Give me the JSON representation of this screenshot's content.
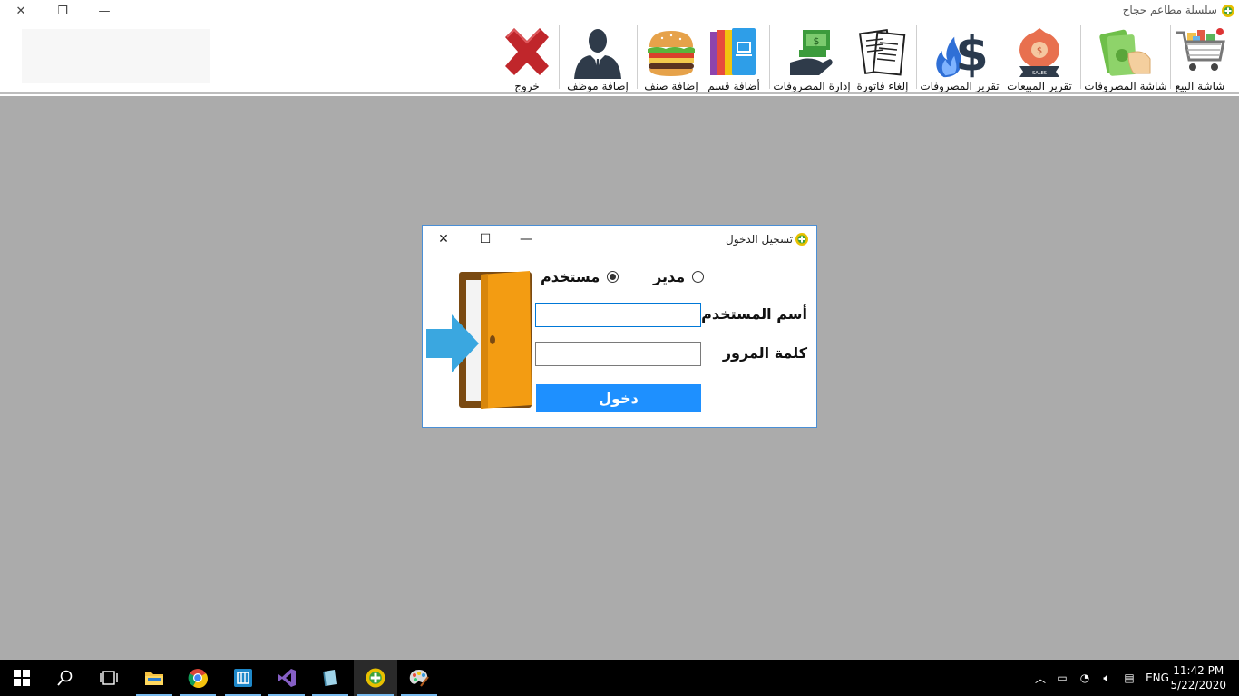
{
  "app": {
    "title": "سلسلة مطاعم حجاج",
    "window_buttons": {
      "close": "✕",
      "restore": "❐",
      "minimize": "—"
    }
  },
  "toolbar": {
    "items": [
      {
        "label": "شاشة البيع",
        "icon": "shopping-cart-icon"
      },
      {
        "label": "شاشة المصروفات",
        "icon": "cash-hand-icon"
      },
      {
        "label": "تقرير المبيعات",
        "icon": "sales-bag-icon"
      },
      {
        "label": "تقرير المصروفات",
        "icon": "dollar-fire-icon"
      },
      {
        "label": "إلغاء فاتورة",
        "icon": "invoice-icon"
      },
      {
        "label": "إدارة المصروفات",
        "icon": "money-hand-icon"
      },
      {
        "label": "أضافة قسم",
        "icon": "category-books-icon"
      },
      {
        "label": "إضافة صنف",
        "icon": "burger-icon"
      },
      {
        "label": "إضافة موظف",
        "icon": "employee-icon"
      },
      {
        "label": "خروج",
        "icon": "exit-x-icon"
      }
    ]
  },
  "login_dialog": {
    "title": "تسجيل الدخول",
    "buttons": {
      "close": "✕",
      "maximize": "☐",
      "minimize": "—"
    },
    "role_admin": "مدير",
    "role_user": "مستخدم",
    "selected_role": "مستخدم",
    "username_label": "أسم المستخدم",
    "username_value": "",
    "password_label": "كلمة المرور",
    "password_value": "",
    "login_button": "دخول"
  },
  "taskbar": {
    "language": "ENG",
    "time": "11:42 PM",
    "date": "5/22/2020"
  },
  "colors": {
    "workspace": "#ababab",
    "login_button": "#1e90ff",
    "taskbar": "#000000"
  }
}
